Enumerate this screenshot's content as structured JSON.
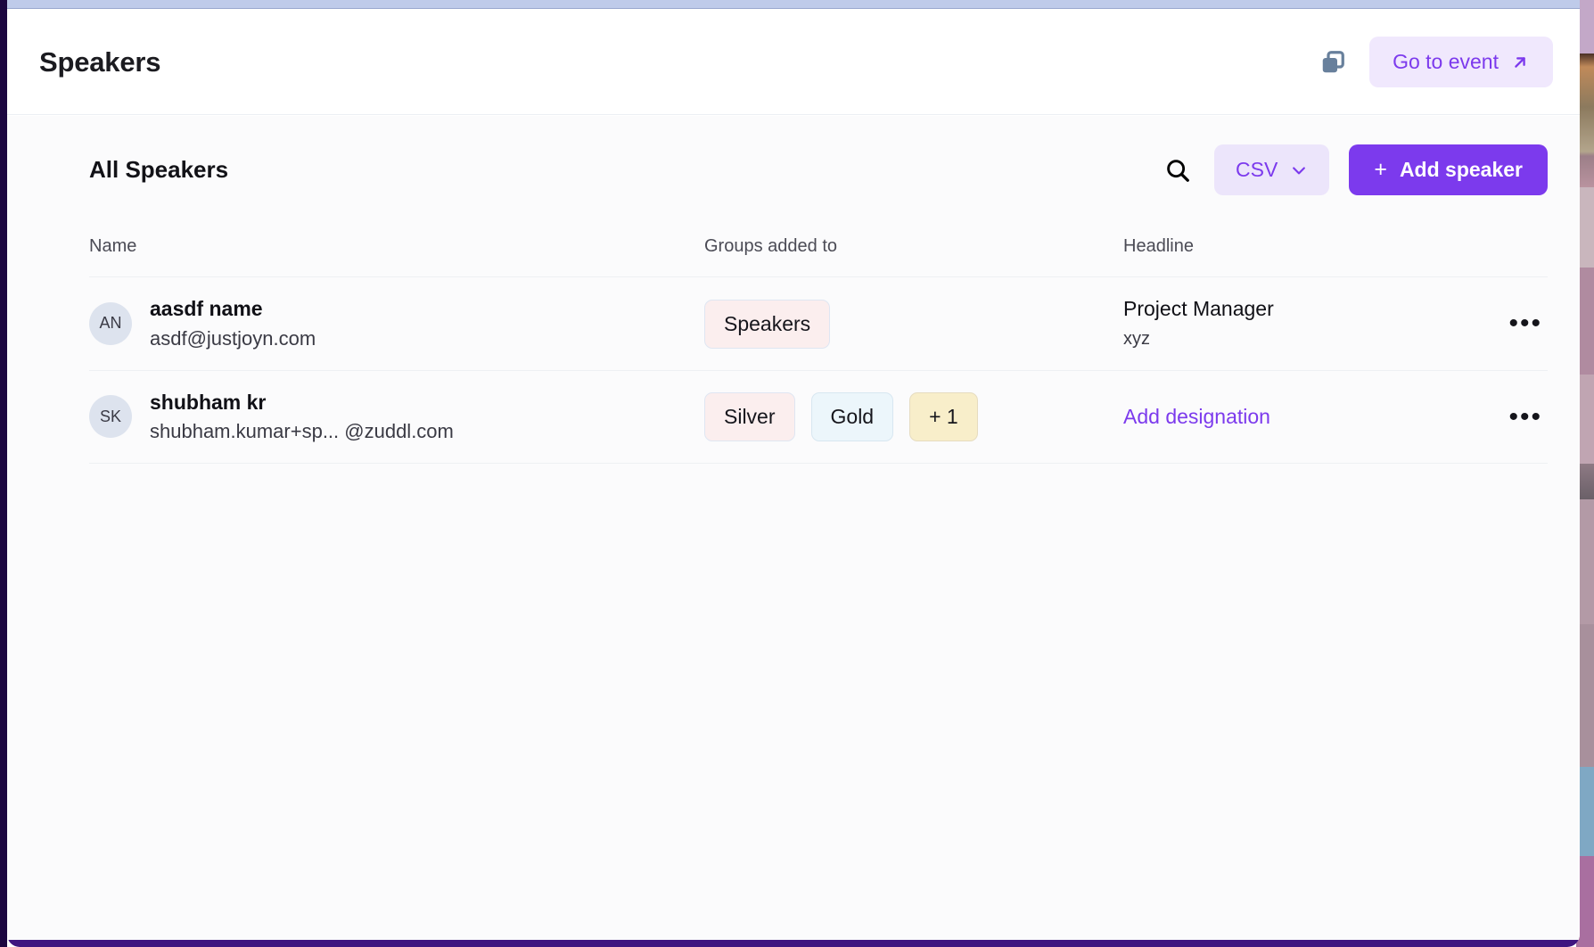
{
  "header": {
    "title": "Speakers",
    "duplicate_icon": "duplicate-icon",
    "go_to_event_label": "Go to event",
    "go_to_event_icon": "arrow-up-right-icon"
  },
  "toolbar": {
    "section_title": "All Speakers",
    "search_icon": "search-icon",
    "csv_label": "CSV",
    "csv_chevron_icon": "chevron-down-icon",
    "add_speaker_plus": "+",
    "add_speaker_label": "Add speaker"
  },
  "table": {
    "columns": [
      "Name",
      "Groups added to",
      "Headline"
    ],
    "rows": [
      {
        "avatar_initials": "AN",
        "name": "aasdf name",
        "email": "asdf@justjoyn.com",
        "groups": [
          {
            "label": "Speakers",
            "style": "tag-pink"
          }
        ],
        "headline": "Project Manager",
        "headline_sub": "xyz",
        "headline_is_link": false,
        "menu_label": "•••"
      },
      {
        "avatar_initials": "SK",
        "name": "shubham kr",
        "email": "shubham.kumar+sp...  @zuddl.com",
        "groups": [
          {
            "label": "Silver",
            "style": "tag-pink"
          },
          {
            "label": "Gold",
            "style": "tag-blue"
          },
          {
            "label": "+ 1",
            "style": "tag-cream"
          }
        ],
        "headline": "Add designation",
        "headline_sub": "",
        "headline_is_link": true,
        "menu_label": "•••"
      }
    ]
  },
  "colors": {
    "accent": "#7c3aed",
    "accent_soft": "#f0e8fd",
    "rail_dark": "#1c0740",
    "rail_purple": "#3f1580",
    "top_strip": "#bfcbea",
    "avatar_bg": "#dde3ee"
  }
}
